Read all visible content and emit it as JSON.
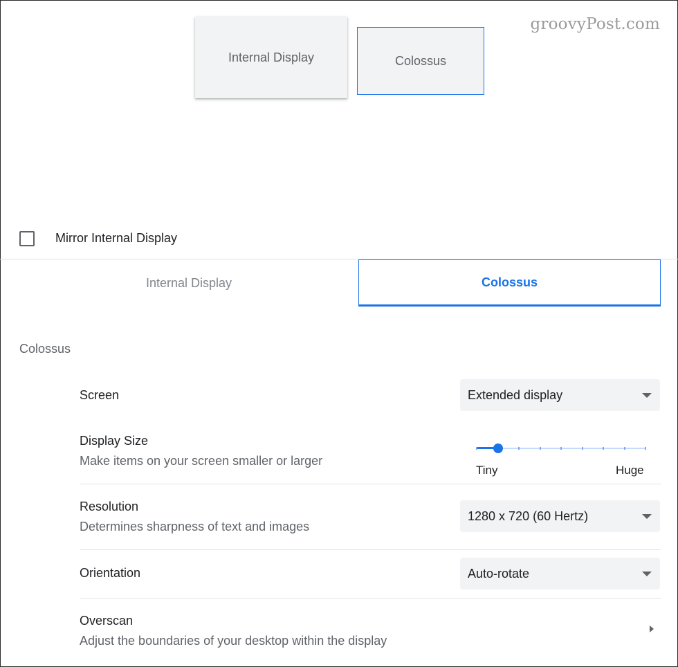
{
  "watermark": "groovyPost.com",
  "arrangement": {
    "internal_label": "Internal Display",
    "external_label": "Colossus"
  },
  "mirror": {
    "label": "Mirror Internal Display",
    "checked": false
  },
  "tabs": [
    {
      "label": "Internal Display",
      "selected": false
    },
    {
      "label": "Colossus",
      "selected": true
    }
  ],
  "section_title": "Colossus",
  "settings": {
    "screen": {
      "label": "Screen",
      "value": "Extended display"
    },
    "display_size": {
      "label": "Display Size",
      "sublabel": "Make items on your screen smaller or larger",
      "min_label": "Tiny",
      "max_label": "Huge",
      "steps": 9,
      "value_step": 1
    },
    "resolution": {
      "label": "Resolution",
      "sublabel": "Determines sharpness of text and images",
      "value": "1280 x 720 (60 Hertz)"
    },
    "orientation": {
      "label": "Orientation",
      "value": "Auto-rotate"
    },
    "overscan": {
      "label": "Overscan",
      "sublabel": "Adjust the boundaries of your desktop within the display"
    }
  },
  "colors": {
    "accent": "#1a73e8",
    "muted_text": "#5f6368",
    "control_bg": "#f1f3f4"
  }
}
